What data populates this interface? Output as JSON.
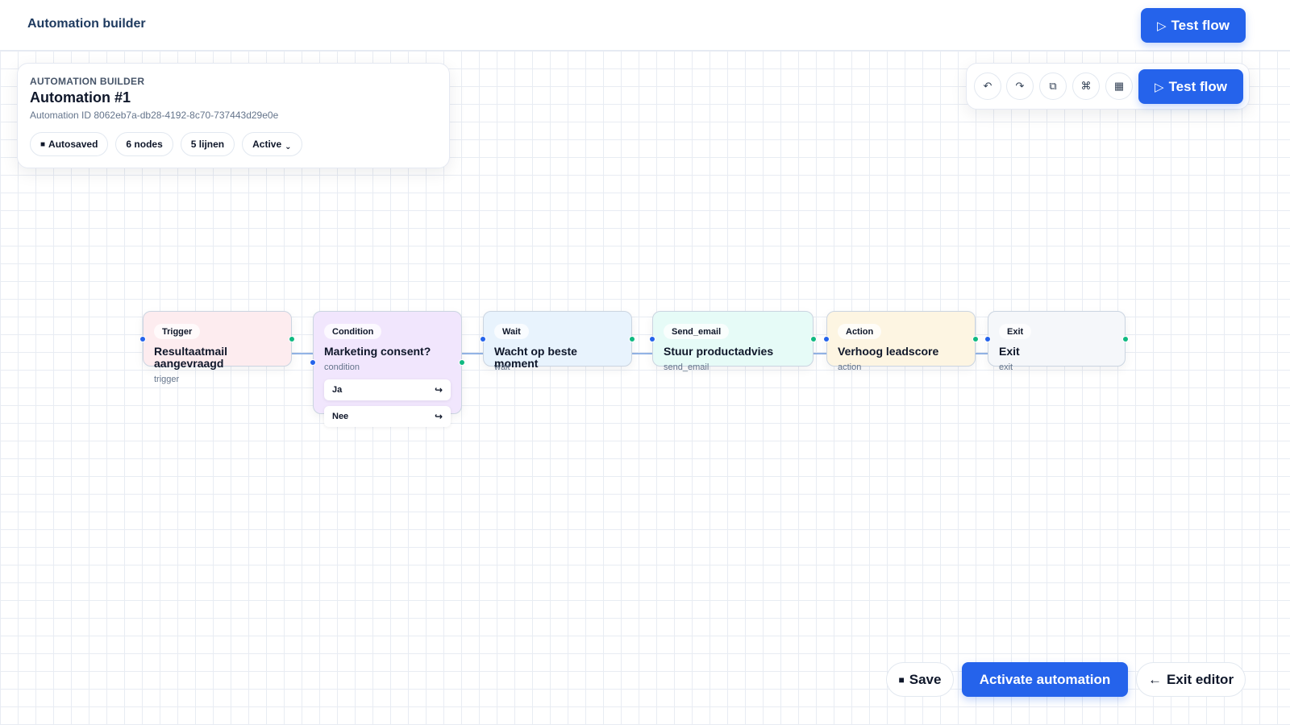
{
  "topbar": {
    "title": "Automation builder",
    "test_flow_icon": "play-icon",
    "test_flow_label": "Test flow"
  },
  "info": {
    "eyebrow": "AUTOMATION BUILDER",
    "title": "Automation #1",
    "id_text": "Automation ID 8062eb7a-db28-4192-8c70-737443d29e0e",
    "pills": {
      "autosaved": "Autosaved",
      "nodes": "6 nodes",
      "lines": "5 lijnen",
      "status": "Active"
    }
  },
  "toolbar": {
    "undo_icon": "undo-icon",
    "redo_icon": "redo-icon",
    "duplicate_icon": "duplicate-icon",
    "command_icon": "command-icon",
    "grid_icon": "grid-icon",
    "test_flow_label": "Test flow"
  },
  "nodes": [
    {
      "badge": "Trigger",
      "title": "Resultaatmail aangevraagd",
      "sub": "trigger",
      "color": "#fdecef"
    },
    {
      "badge": "Condition",
      "title": "Marketing consent?",
      "sub": "condition",
      "color": "#f1e6fd"
    },
    {
      "badge": "Wait",
      "title": "Wacht op beste moment",
      "sub": "wait",
      "color": "#e8f3fd"
    },
    {
      "badge": "Send_email",
      "title": "Stuur productadvies",
      "sub": "send_email",
      "color": "#e6fbf7"
    },
    {
      "badge": "Action",
      "title": "Verhoog leadscore",
      "sub": "action",
      "color": "#fdf5e2"
    },
    {
      "badge": "Exit",
      "title": "Exit",
      "sub": "exit",
      "color": "#f5f7fa"
    }
  ],
  "branches": [
    {
      "label": "Ja"
    },
    {
      "label": "Nee"
    }
  ],
  "footer": {
    "save_label": "Save",
    "activate_label": "Activate automation",
    "exit_label": "Exit editor"
  },
  "colors": {
    "accent": "#2563eb",
    "port_in": "#2563eb",
    "port_out": "#10b981"
  }
}
